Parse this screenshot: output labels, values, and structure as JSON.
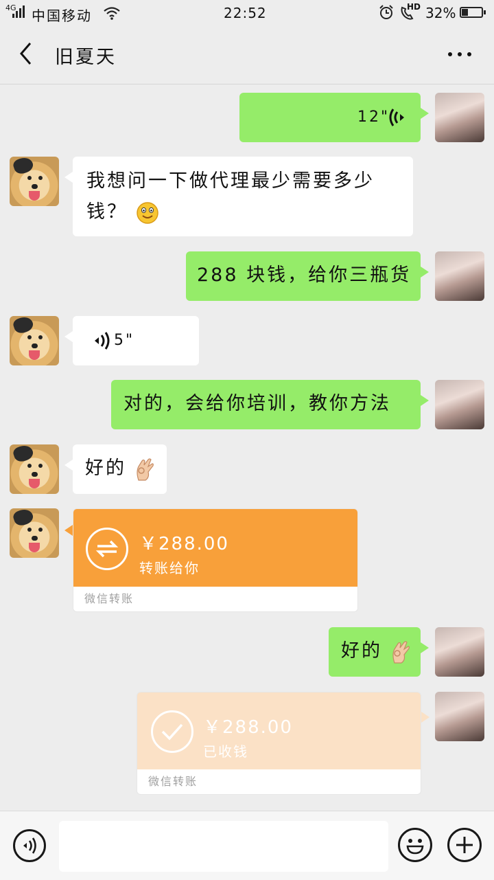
{
  "status_bar": {
    "network_type": "4G",
    "carrier": "中国移动",
    "time": "22:52",
    "hd_label": "HD",
    "battery_percent": "32%",
    "battery_level": 0.32
  },
  "header": {
    "title": "旧夏天"
  },
  "messages": [
    {
      "side": "right",
      "type": "voice",
      "duration": "12\""
    },
    {
      "side": "left",
      "type": "text",
      "line1": "我想问一下做代理最少需要多少",
      "line2": "钱？"
    },
    {
      "side": "right",
      "type": "text",
      "text": "288 块钱，给你三瓶货"
    },
    {
      "side": "left",
      "type": "voice",
      "duration": "5\""
    },
    {
      "side": "right",
      "type": "text",
      "text": "对的，会给你培训，教你方法"
    },
    {
      "side": "left",
      "type": "text",
      "text": "好的"
    },
    {
      "side": "left",
      "type": "transfer",
      "amount": "￥288.00",
      "desc": "转账给你",
      "footer": "微信转账"
    },
    {
      "side": "right",
      "type": "text",
      "text": "好的"
    },
    {
      "side": "right",
      "type": "transfer",
      "amount": "￥288.00",
      "desc": "已收钱",
      "footer": "微信转账"
    }
  ],
  "colors": {
    "self_bubble": "#95ec69",
    "transfer_pending": "#f8a03a",
    "transfer_received": "#fbe1c6"
  },
  "icons": {
    "back": "chevron-left-icon",
    "more": "ellipsis-icon",
    "voice_input": "voice-icon",
    "emoji": "smiley-icon",
    "add": "plus-icon"
  }
}
